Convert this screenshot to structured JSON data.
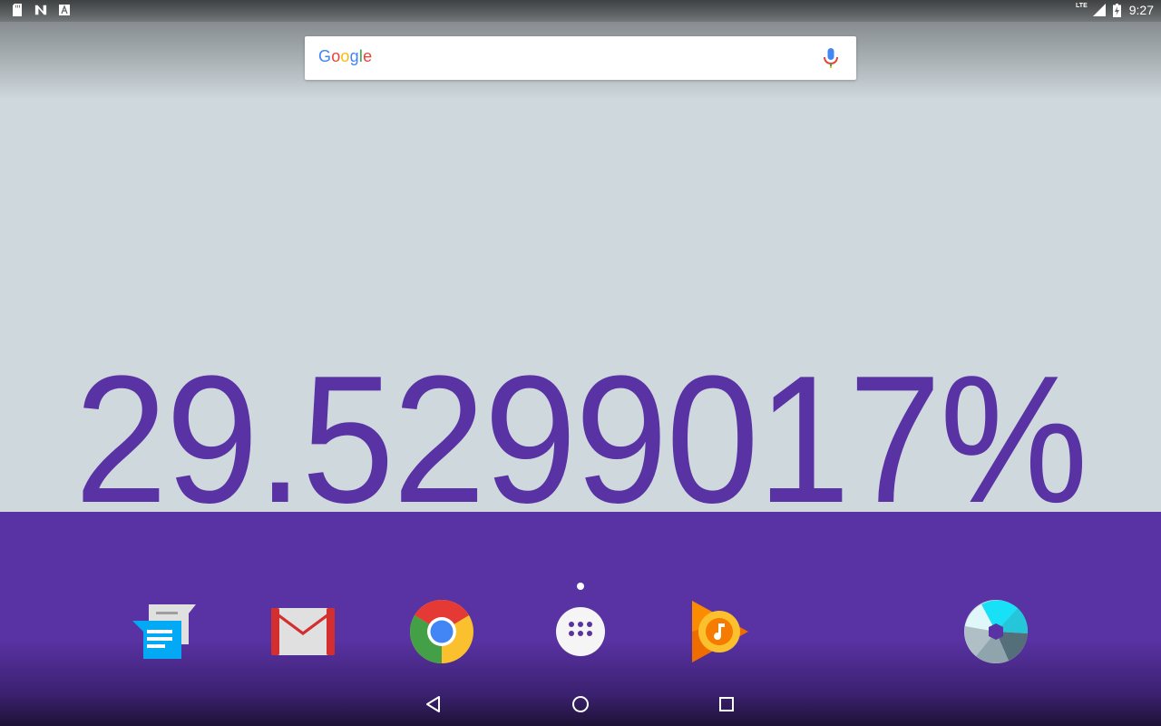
{
  "status_bar": {
    "time": "9:27",
    "network_label": "LTE",
    "left_icons": [
      "sd-card-icon",
      "n-notification-icon",
      "a-notification-icon"
    ],
    "right_icons": [
      "signal-icon",
      "battery-charging-icon"
    ]
  },
  "search": {
    "logo_letters": [
      {
        "ch": "G",
        "color": "#4285F4"
      },
      {
        "ch": "o",
        "color": "#EA4335"
      },
      {
        "ch": "o",
        "color": "#FBBC05"
      },
      {
        "ch": "g",
        "color": "#4285F4"
      },
      {
        "ch": "l",
        "color": "#34A853"
      },
      {
        "ch": "e",
        "color": "#EA4335"
      }
    ],
    "mic_icon": "mic-icon"
  },
  "widget": {
    "battery_percent": "29.5299017%",
    "color": "#5932a3"
  },
  "dock": {
    "apps": [
      {
        "name": "messages-app",
        "icon": "messages-icon"
      },
      {
        "name": "gmail-app",
        "icon": "gmail-icon"
      },
      {
        "name": "chrome-app",
        "icon": "chrome-icon"
      },
      {
        "name": "app-drawer",
        "icon": "apps-grid-icon"
      },
      {
        "name": "play-music-app",
        "icon": "play-music-icon"
      },
      {
        "name": "camera-app",
        "icon": "camera-icon"
      }
    ]
  },
  "nav_bar": {
    "buttons": [
      "back-icon",
      "home-icon",
      "recents-icon"
    ]
  },
  "colors": {
    "wallpaper_top": "#cfd8dd",
    "wallpaper_bottom": "#5932a3"
  }
}
